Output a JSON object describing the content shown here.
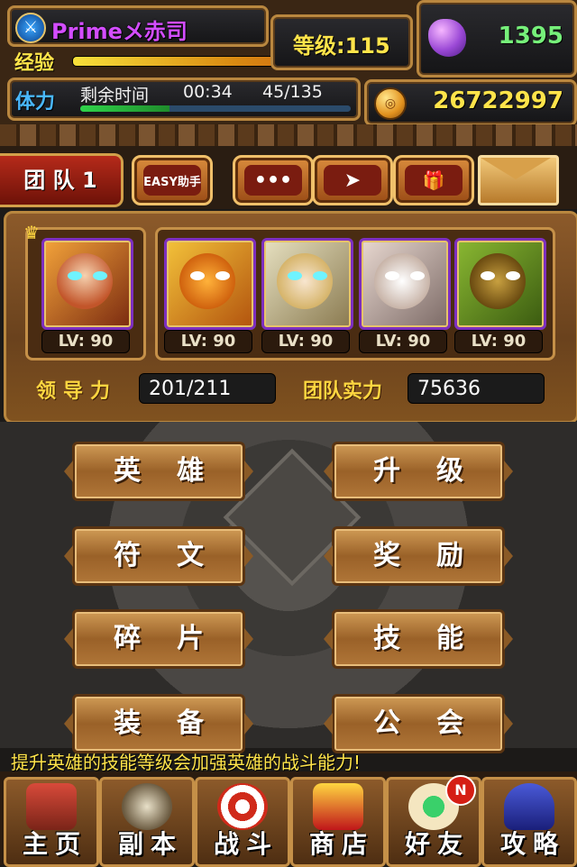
{
  "header": {
    "player_name": "Primeメ赤司",
    "level_text": "等级:115",
    "exp_label": "经验",
    "exp_progress": 0.98,
    "gems": "1395",
    "stamina_label": "体力",
    "remaining_time_label": "剩余时间",
    "remaining_time": "00:34",
    "stamina_value": "45/135",
    "stamina_progress": 0.33,
    "gold": "26722997"
  },
  "actions": {
    "team_label": "团 队 1",
    "easy_helper_label": "EASY助手",
    "chat_icon": "chat-icon",
    "send_icon": "send-icon",
    "gift_icon": "gift-icon",
    "mail_icon": "mail-icon"
  },
  "team": {
    "leader_level": "LV: 90",
    "member_levels": [
      "LV: 90",
      "LV: 90",
      "LV: 90",
      "LV: 90"
    ],
    "leadership_label": "领导力",
    "leadership_value": "201/211",
    "power_label": "团队实力",
    "power_value": "75636"
  },
  "menu": {
    "heroes": "英雄",
    "upgrade": "升级",
    "runes": "符文",
    "rewards": "奖励",
    "fragments": "碎片",
    "skills": "技能",
    "equipment": "装备",
    "guild": "公会"
  },
  "tip": "提升英雄的技能等级会加强英雄的战斗能力!",
  "nav": {
    "home": "主页",
    "dungeon": "副本",
    "battle": "战斗",
    "shop": "商店",
    "friends": "好友",
    "guide": "攻略",
    "new_badge": "N"
  },
  "colors": {
    "gold_text": "#ffe44a",
    "gem_text": "#76f07a",
    "name_text": "#d34dff",
    "hero_frame": "#7d2fbf"
  }
}
